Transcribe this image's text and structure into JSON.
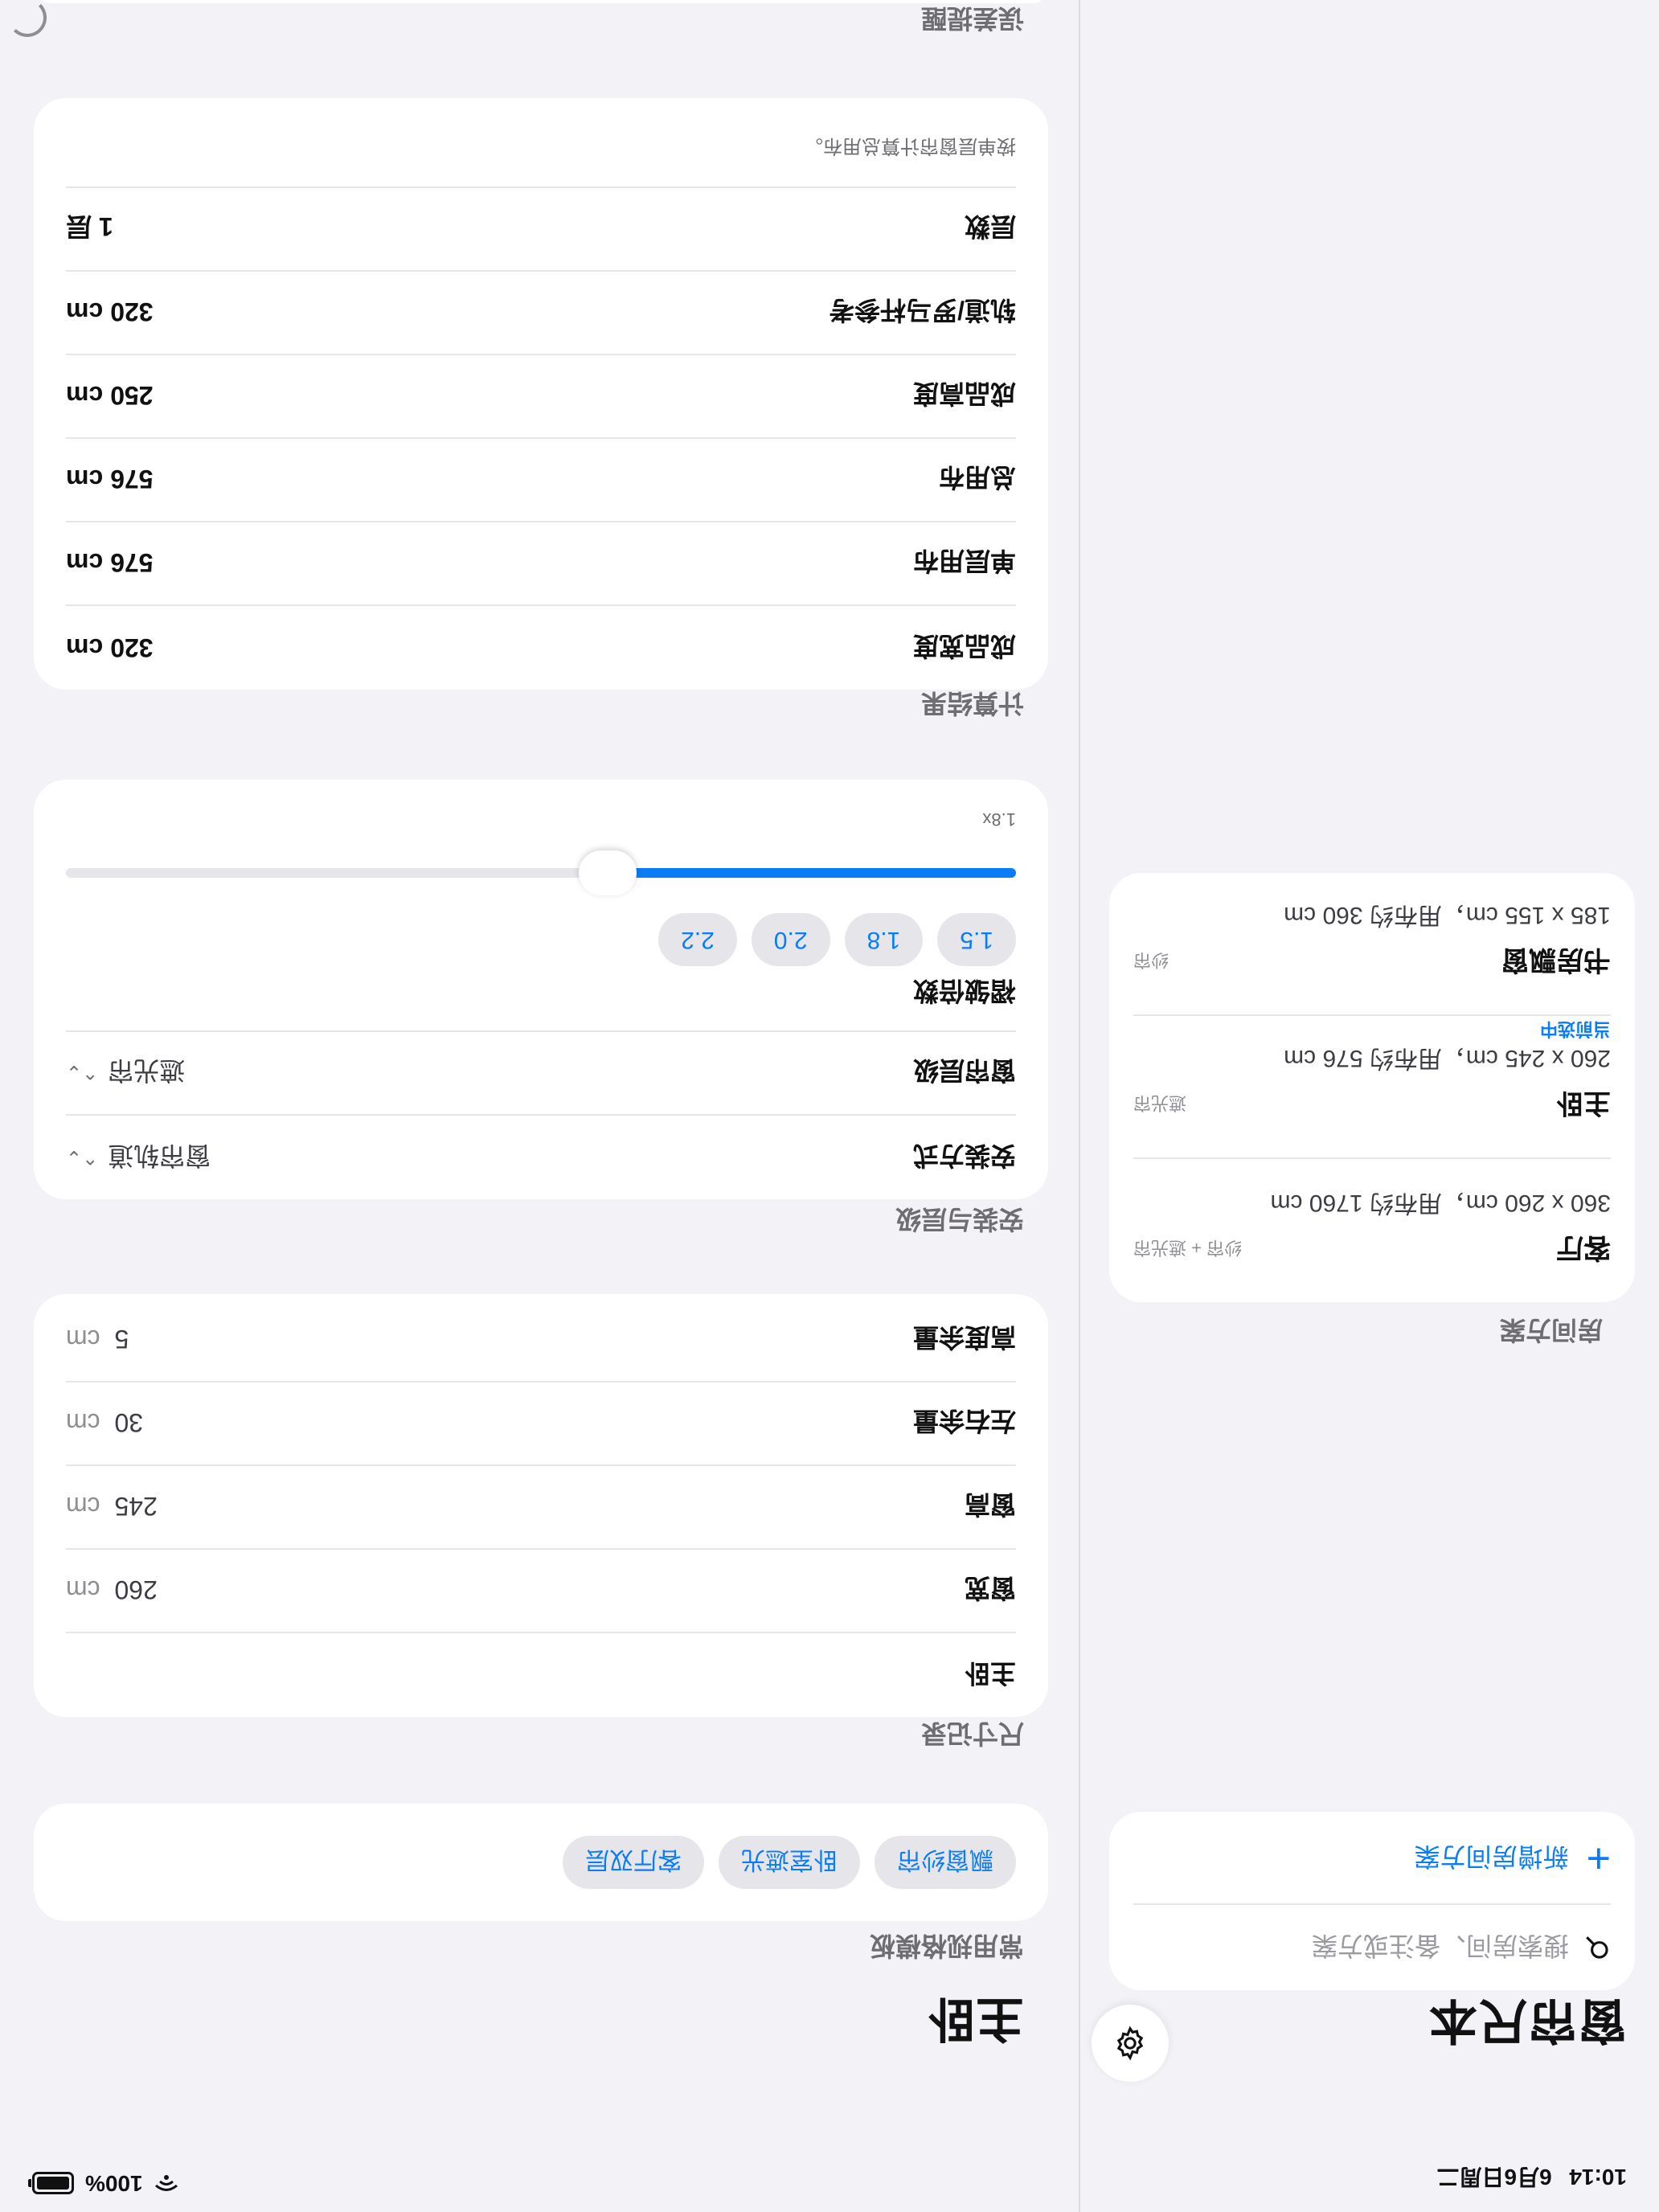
{
  "status": {
    "time": "10:14",
    "date": "6月6日周二",
    "battery": "100%"
  },
  "sidebar": {
    "title": "窗帘尺本",
    "search_placeholder": "搜索房间、备注或方案",
    "add_label": "新增房间方案",
    "rooms_header": "房间方案",
    "rooms": [
      {
        "name": "客厅",
        "tag": "纱帘 + 遮光帘",
        "dims": "360 x 260 cm，用布约 1760 cm"
      },
      {
        "name": "主卧",
        "tag": "遮光帘",
        "dims": "260 x 245 cm，用布约 576 cm",
        "current": "当前选中"
      },
      {
        "name": "书房飘窗",
        "tag": "纱帘",
        "dims": "185 x 155 cm，用布约 360 cm"
      }
    ]
  },
  "detail": {
    "title": "主卧",
    "presets": {
      "header": "常用规格模板",
      "items": [
        "飘窗纱帘",
        "卧室遮光",
        "客厅双层"
      ]
    },
    "dimensions": {
      "header": "尺寸记录",
      "name": "主卧",
      "rows": [
        {
          "label": "窗宽",
          "value": "260",
          "unit": "cm"
        },
        {
          "label": "窗高",
          "value": "245",
          "unit": "cm"
        },
        {
          "label": "左右余量",
          "value": "30",
          "unit": "cm"
        },
        {
          "label": "高度余量",
          "value": "5",
          "unit": "cm"
        }
      ]
    },
    "install": {
      "header": "安装与层级",
      "method_label": "安装方式",
      "method_value": "窗帘轨道",
      "layer_label": "窗帘层级",
      "layer_value": "遮光帘",
      "multiplier_label": "褶皱倍数",
      "multiplier_options": [
        "1.5",
        "1.8",
        "2.0",
        "2.2"
      ],
      "multiplier_value": "1.8x",
      "slider_fraction": 0.43
    },
    "results": {
      "header": "计算结果",
      "rows": [
        {
          "label": "成品宽度",
          "value": "320 cm"
        },
        {
          "label": "单层用布",
          "value": "576 cm"
        },
        {
          "label": "总用布",
          "value": "576 cm"
        },
        {
          "label": "成品高度",
          "value": "250 cm"
        },
        {
          "label": "轨道/罗马杆参考",
          "value": "320 cm"
        },
        {
          "label": "层数",
          "value": "1 层"
        }
      ],
      "note": "按单层窗帘计算总用布。"
    },
    "next_header": "误差提醒"
  }
}
